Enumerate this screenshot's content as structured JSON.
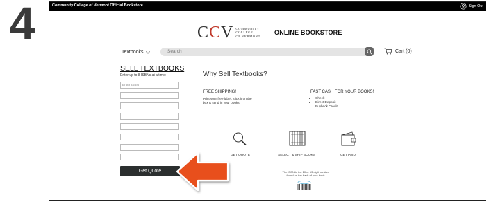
{
  "step_number": "4",
  "topbar": {
    "store_name": "Community College of Vermont Official Bookstore",
    "sign_out": "Sign Out"
  },
  "logo": {
    "mark": "CCV",
    "sub_lines": [
      "Community",
      "College",
      "of Vermont"
    ],
    "store_label": "ONLINE BOOKSTORE"
  },
  "nav": {
    "textbooks": "Textbooks",
    "search_placeholder": "Search",
    "cart": "Cart (0)"
  },
  "sell": {
    "heading": "SELL TEXTBOOKS",
    "instructions": "Enter up to 8 ISBNs at a time:",
    "isbn_placeholder": "Enter ISBN",
    "isbn_field_count": 8,
    "button": "Get Quote"
  },
  "why": {
    "heading": "Why Sell Textbooks?",
    "shipping_title": "FREE SHIPPING!",
    "shipping_text_1": "Print your free label, stick it on the",
    "shipping_text_2": "box & send in your books!",
    "cash_title": "FAST CASH FOR YOUR BOOKS!",
    "cash_options": [
      "Check",
      "Direct Deposit",
      "Buyback Credit"
    ]
  },
  "steps": [
    {
      "label": "GET QUOTE",
      "icon": "magnifier-icon"
    },
    {
      "label": "SELECT & SHIP BOOKS",
      "icon": "books-icon"
    },
    {
      "label": "GET PAID",
      "icon": "wallet-icon"
    }
  ],
  "isbn_note": {
    "line1": "The ISBN is the 10 or 13 digit number",
    "line2": "found on the back of your book"
  },
  "colors": {
    "topbar": "#000000",
    "button": "#2b2f2f",
    "arrow": "#e8501e",
    "accent_red": "#c0392b"
  }
}
